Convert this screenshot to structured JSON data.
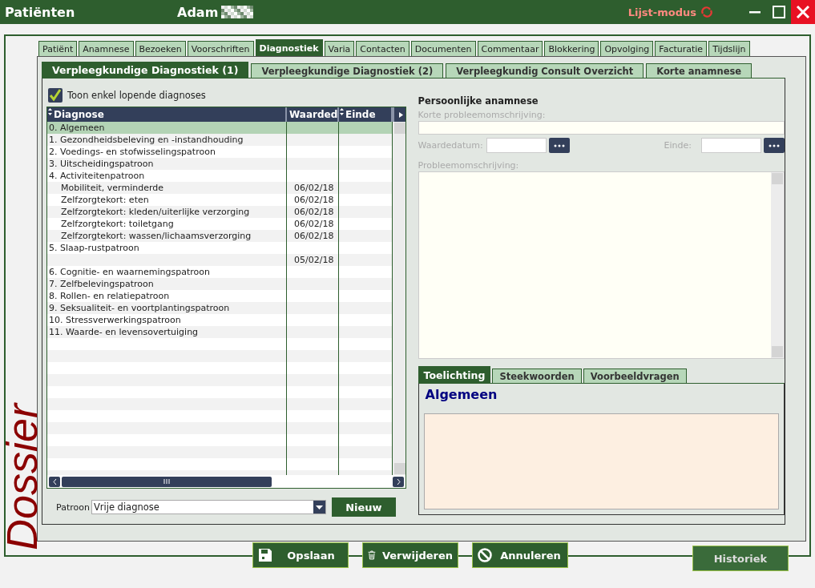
{
  "window": {
    "title": "Patiënten",
    "patient_name": "Adam",
    "mode": "Lijst-modus"
  },
  "side_label": "Dossier",
  "tabs": [
    {
      "label": "Patiënt",
      "selected": false
    },
    {
      "label": "Anamnese",
      "selected": false
    },
    {
      "label": "Bezoeken",
      "selected": false
    },
    {
      "label": "Voorschriften",
      "selected": false
    },
    {
      "label": "Diagnostiek",
      "selected": true
    },
    {
      "label": "Varia",
      "selected": false
    },
    {
      "label": "Contacten",
      "selected": false
    },
    {
      "label": "Documenten",
      "selected": false
    },
    {
      "label": "Commentaar",
      "selected": false
    },
    {
      "label": "Blokkering",
      "selected": false
    },
    {
      "label": "Opvolging",
      "selected": false
    },
    {
      "label": "Facturatie",
      "selected": false
    },
    {
      "label": "Tijdslijn",
      "selected": false
    }
  ],
  "sub_tabs": [
    {
      "label": "Verpleegkundige Diagnostiek (1)",
      "selected": true
    },
    {
      "label": "Verpleegkundige Diagnostiek (2)",
      "selected": false
    },
    {
      "label": "Verpleegkundig Consult Overzicht",
      "selected": false
    },
    {
      "label": "Korte anamnese",
      "selected": false
    }
  ],
  "filter": {
    "label": "Toon enkel lopende diagnoses",
    "checked": true
  },
  "table": {
    "columns": [
      "Diagnose",
      "Waarded",
      "Einde"
    ],
    "rows": [
      {
        "diagnose": "0. Algemeen",
        "selected": true
      },
      {
        "diagnose": "1. Gezondheidsbeleving en -instandhouding",
        "selected": false
      },
      {
        "diagnose": "2. Voedings- en stofwisselingspatroon",
        "selected": false
      },
      {
        "diagnose": "3. Uitscheidingspatroon",
        "selected": false
      },
      {
        "diagnose": "4. Activiteitenpatroon",
        "selected": false,
        "children": [
          {
            "diagnose": "Mobiliteit, verminderde",
            "waardedatum": "06/02/18",
            "selected": false
          },
          {
            "diagnose": "Zelfzorgtekort: eten",
            "waardedatum": "06/02/18",
            "selected": false
          },
          {
            "diagnose": "Zelfzorgtekort: kleden/uiterlijke verzorging",
            "waardedatum": "06/02/18",
            "selected": false
          },
          {
            "diagnose": "Zelfzorgtekort: toiletgang",
            "waardedatum": "06/02/18",
            "selected": false
          },
          {
            "diagnose": "Zelfzorgtekort: wassen/lichaamsverzorging",
            "waardedatum": "06/02/18",
            "selected": false
          }
        ]
      },
      {
        "diagnose": "5. Slaap-rustpatroon",
        "selected": false,
        "children": [
          {
            "waardedatum": "05/02/18",
            "selected": false
          }
        ]
      },
      {
        "diagnose": "6. Cognitie- en waarnemingspatroon",
        "selected": false
      },
      {
        "diagnose": "7. Zelfbelevingspatroon",
        "selected": false
      },
      {
        "diagnose": "8. Rollen- en relatiepatroon",
        "selected": false
      },
      {
        "diagnose": "9. Seksualiteit- en voortplantingspatroon",
        "selected": false
      },
      {
        "diagnose": "10. Stressverwerkingspatroon",
        "selected": false
      },
      {
        "diagnose": "11. Waarde- en levensovertuiging",
        "selected": false
      }
    ]
  },
  "patroon": {
    "label": "Patroon",
    "value": "Vrije diagnose",
    "button": "Nieuw"
  },
  "anamnese": {
    "title": "Persoonlijke anamnese",
    "short_label": "Korte probleemomschrijving:",
    "date_label": "Waardedatum:",
    "end_label": "Einde:",
    "long_label": "Probleemomschrijving:"
  },
  "info_tabs": [
    {
      "label": "Toelichting",
      "selected": true
    },
    {
      "label": "Steekwoorden",
      "selected": false
    },
    {
      "label": "Voorbeeldvragen",
      "selected": false
    }
  ],
  "info_heading": "Algemeen",
  "buttons": [
    {
      "label": "Opslaan",
      "kind": "save"
    },
    {
      "label": "Verwijderen",
      "kind": "delete"
    },
    {
      "label": "Annuleren",
      "kind": "cancel"
    }
  ],
  "history_button": "Historiek"
}
